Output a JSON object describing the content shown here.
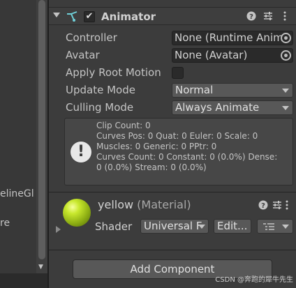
{
  "left_panel": {
    "items": [
      "elineGl",
      "re"
    ]
  },
  "component": {
    "title": "Animator",
    "enabled": true,
    "icons": [
      "help-icon",
      "preset-icon",
      "more-icon"
    ]
  },
  "properties": {
    "controller_label": "Controller",
    "controller_value": "None (Runtime Anima",
    "avatar_label": "Avatar",
    "avatar_value": "None (Avatar)",
    "apply_root_motion_label": "Apply Root Motion",
    "apply_root_motion_checked": false,
    "update_mode_label": "Update Mode",
    "update_mode_value": "Normal",
    "culling_mode_label": "Culling Mode",
    "culling_mode_value": "Always Animate"
  },
  "info": {
    "lines": [
      "Clip Count: 0",
      "Curves Pos: 0 Quat: 0 Euler: 0 Scale: 0",
      "Muscles: 0 Generic: 0 PPtr: 0",
      "Curves Count: 0 Constant: 0 (0.0%) Dense:",
      "0 (0.0%) Stream: 0 (0.0%)"
    ]
  },
  "material": {
    "name": "yellow",
    "type": "(Material)",
    "shader_label": "Shader",
    "shader_value": "Universal F",
    "edit_label": "Edit...",
    "ball_color": "#b5d420"
  },
  "add_component_label": "Add Component",
  "watermark": "CSDN @奔跑的犀牛先生"
}
